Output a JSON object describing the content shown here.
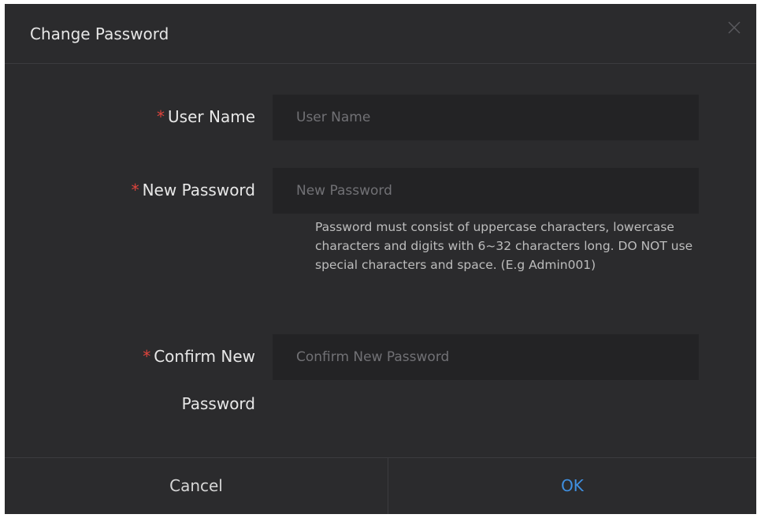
{
  "dialog": {
    "title": "Change Password",
    "close_icon": "close-icon"
  },
  "form": {
    "required_mark": "*",
    "user_name": {
      "label": "User Name",
      "placeholder": "User Name",
      "value": ""
    },
    "new_password": {
      "label": "New Password",
      "placeholder": "New Password",
      "value": "",
      "hint": "Password must consist of uppercase characters, lowercase characters and digits with 6~32 characters long. DO NOT use special characters and space. (E.g Admin001)"
    },
    "confirm_password": {
      "label_line1": "Confirm New",
      "label_line2": "Password",
      "placeholder": "Confirm New Password",
      "value": ""
    }
  },
  "footer": {
    "cancel_label": "Cancel",
    "ok_label": "OK"
  },
  "colors": {
    "background": "#2b2b2d",
    "input_background": "#232325",
    "required": "#e0443c",
    "ok_accent": "#3f8fe0"
  }
}
